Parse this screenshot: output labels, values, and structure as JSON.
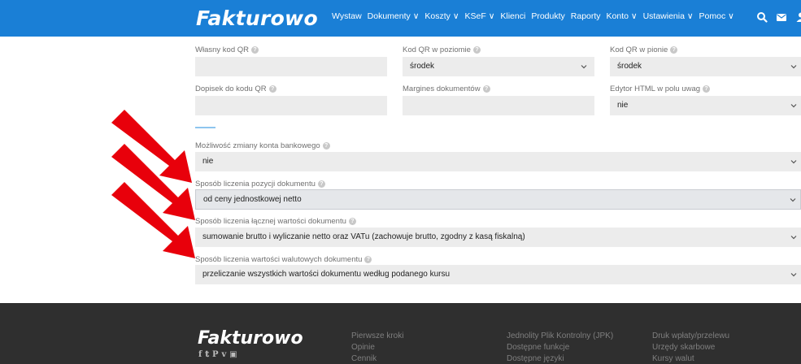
{
  "navbar": {
    "logo": "Fakturowo",
    "items": [
      {
        "label": "Wystaw"
      },
      {
        "label": "Dokumenty ∨"
      },
      {
        "label": "Koszty ∨"
      },
      {
        "label": "KSeF ∨"
      },
      {
        "label": "Klienci"
      },
      {
        "label": "Produkty"
      },
      {
        "label": "Raporty"
      },
      {
        "label": "Konto ∨"
      },
      {
        "label": "Ustawienia ∨"
      },
      {
        "label": "Pomoc ∨"
      }
    ],
    "icons": [
      "search-icon",
      "mail-icon",
      "user-icon"
    ],
    "color": "#1a7fd6"
  },
  "form": {
    "qr_code": {
      "label": "Własny kod QR",
      "value": ""
    },
    "qr_horizontal": {
      "label": "Kod QR w poziomie",
      "value": "środek"
    },
    "qr_vertical": {
      "label": "Kod QR w pionie",
      "value": "środek"
    },
    "qr_note": {
      "label": "Dopisek do kodu QR",
      "value": ""
    },
    "doc_margins": {
      "label": "Margines dokumentów",
      "value": ""
    },
    "html_editor": {
      "label": "Edytor HTML w polu uwag",
      "value": "nie"
    },
    "bank_account_change": {
      "label": "Możliwość zmiany konta bankowego",
      "value": "nie"
    },
    "item_calculation": {
      "label": "Sposób liczenia pozycji dokumentu",
      "value": "od ceny jednostkowej netto"
    },
    "total_calculation": {
      "label": "Sposób liczenia łącznej wartości dokumentu",
      "value": "sumowanie brutto i wyliczanie netto oraz VATu (zachowuje brutto, zgodny z kasą fiskalną)"
    },
    "currency_calculation": {
      "label": "Sposób liczenia wartości walutowych dokumentu",
      "value": "przeliczanie wszystkich wartości dokumentu według podanego kursu"
    }
  },
  "footer": {
    "logo": "Fakturowo",
    "social": [
      "f",
      "t",
      "p",
      "v",
      "yt"
    ],
    "col1": [
      "Pierwsze kroki",
      "Opinie",
      "Cennik"
    ],
    "col2": [
      "Jednolity Plik Kontrolny (JPK)",
      "Dostępne funkcje",
      "Dostępne języki"
    ],
    "col3": [
      "Druk wpłaty/przelewu",
      "Urzędy skarbowe",
      "Kursy walut"
    ]
  },
  "annotation": {
    "arrow_color": "#e8000b"
  }
}
